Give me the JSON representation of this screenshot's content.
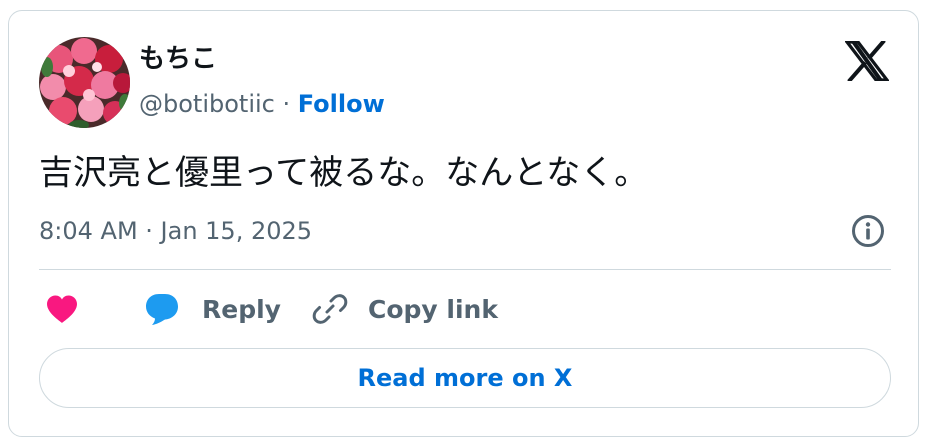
{
  "author": {
    "display_name": "もちこ",
    "handle": "@botibotiic",
    "separator": " · ",
    "follow_label": "Follow",
    "avatar_icon": "flower-bouquet-avatar"
  },
  "tweet": {
    "text": "吉沢亮と優里って被るな。なんとなく。",
    "timestamp": "8:04 AM · Jan 15, 2025"
  },
  "actions": {
    "like_icon": "heart-icon",
    "reply_label": "Reply",
    "reply_icon": "speech-bubble-icon",
    "copy_label": "Copy link",
    "copy_icon": "link-icon"
  },
  "footer": {
    "read_more_label": "Read more on X"
  },
  "colors": {
    "accent": "#006fd6",
    "like": "#f91880",
    "reply": "#1d9bf0",
    "muted": "#536471",
    "text": "#0f1419",
    "border": "#cfd9de"
  }
}
